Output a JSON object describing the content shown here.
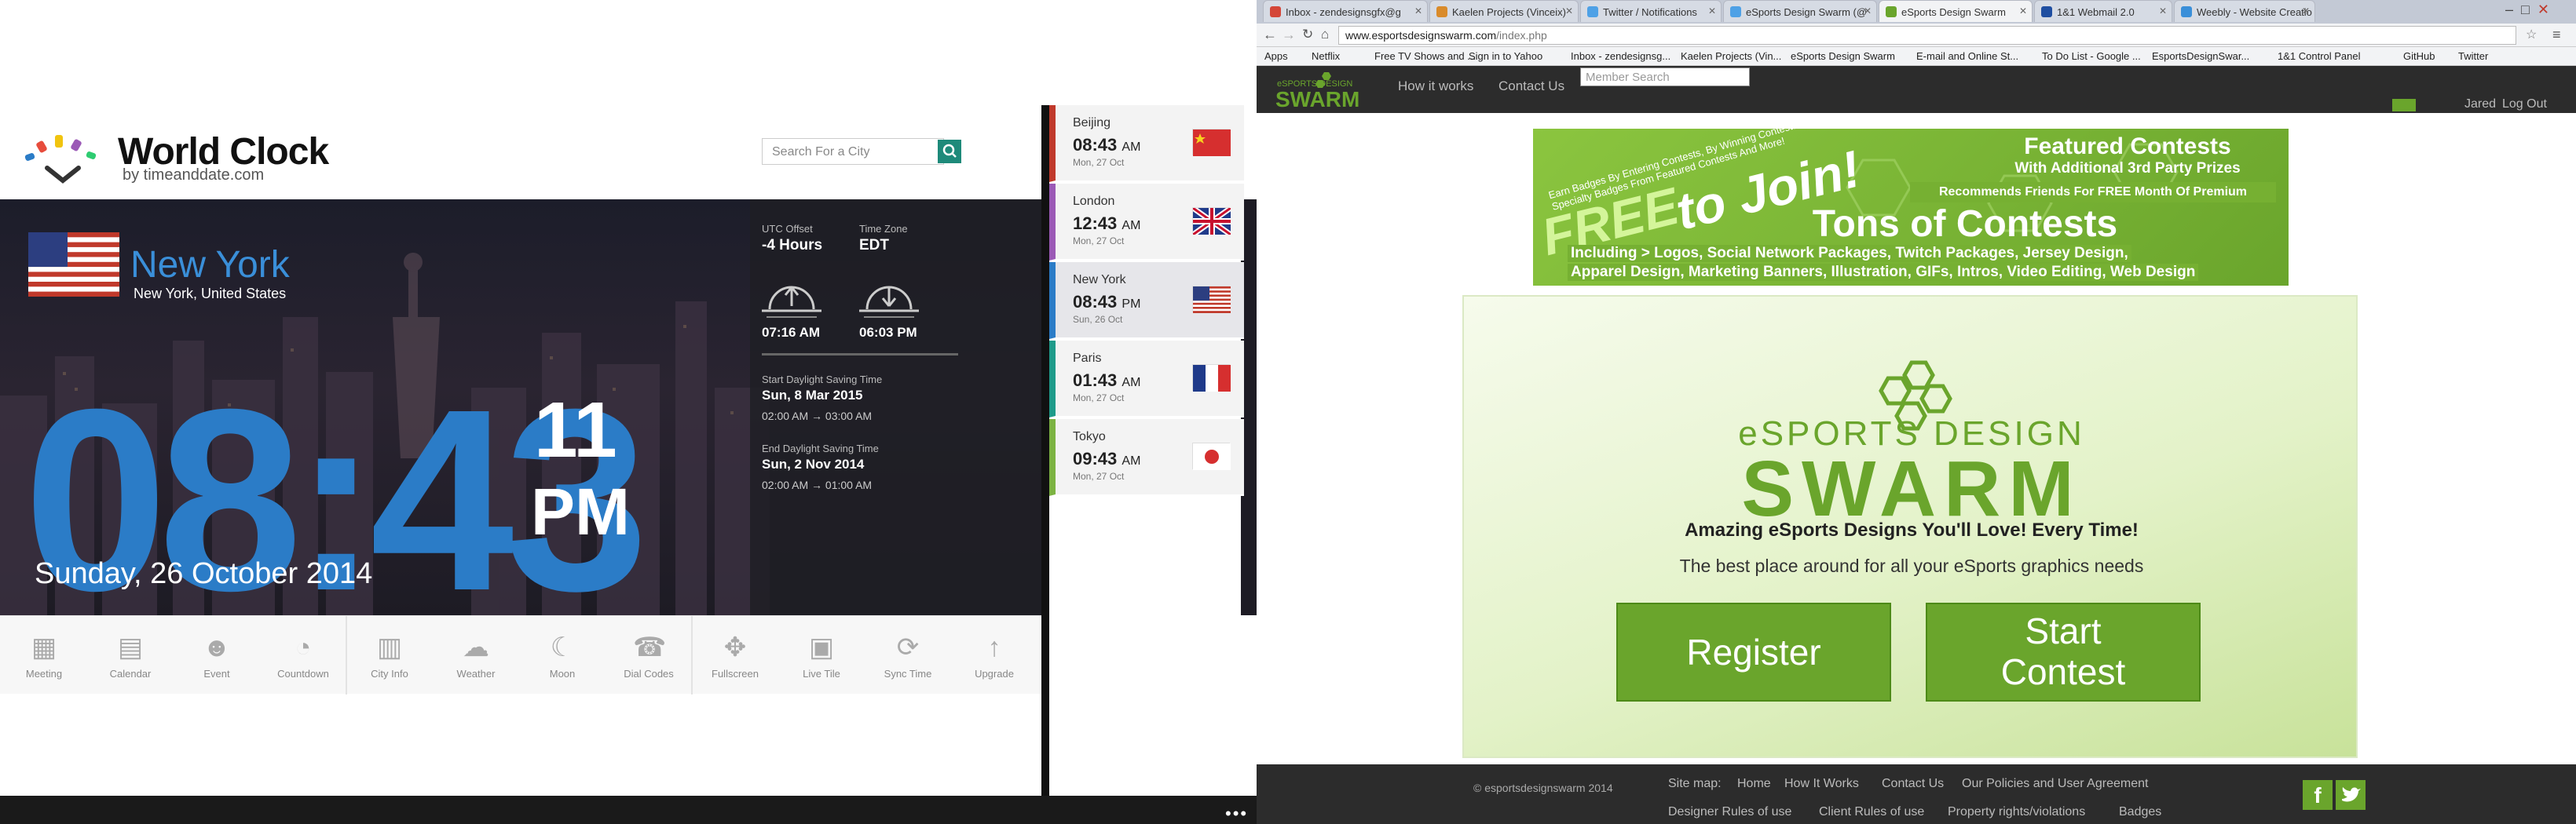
{
  "world_clock": {
    "logo_title": "World Clock",
    "logo_sub": "by timeanddate.com",
    "search_placeholder": "Search For a City",
    "city": "New York",
    "city_full": "New York, United States",
    "utc_offset_label": "UTC Offset",
    "utc_offset": "-4 Hours",
    "tz_label": "Time Zone",
    "tz": "EDT",
    "sunrise": "07:16 AM",
    "sunset": "06:03 PM",
    "dst_start_label": "Start Daylight Saving Time",
    "dst_start": "Sun, 8 Mar 2015",
    "dst_start_change": "02:00 AM → 03:00 AM",
    "dst_end_label": "End Daylight Saving Time",
    "dst_end": "Sun, 2 Nov 2014",
    "dst_end_change": "02:00 AM → 01:00 AM",
    "time_hm": "08:43",
    "seconds": "11",
    "ampm": "PM",
    "date": "Sunday, 26 October 2014",
    "toolbar": [
      "Meeting",
      "Calendar",
      "Event",
      "Countdown",
      "City Info",
      "Weather",
      "Moon",
      "Dial Codes",
      "Fullscreen",
      "Live Tile",
      "Sync Time",
      "Upgrade"
    ],
    "cities": [
      {
        "name": "Beijing",
        "time": "08:43",
        "ampm": "AM",
        "date": "Mon, 27 Oct",
        "color": "#c0392b"
      },
      {
        "name": "London",
        "time": "12:43",
        "ampm": "AM",
        "date": "Mon, 27 Oct",
        "color": "#9b59b6"
      },
      {
        "name": "New York",
        "time": "08:43",
        "ampm": "PM",
        "date": "Sun, 26 Oct",
        "color": "#2b7cc7"
      },
      {
        "name": "Paris",
        "time": "01:43",
        "ampm": "AM",
        "date": "Mon, 27 Oct",
        "color": "#1e9b8a"
      },
      {
        "name": "Tokyo",
        "time": "09:43",
        "ampm": "AM",
        "date": "Mon, 27 Oct",
        "color": "#7cb342"
      }
    ]
  },
  "browser": {
    "tabs": [
      "Inbox - zendesignsgfx@g",
      "Kaelen Projects (Vinceix)",
      "Twitter / Notifications",
      "eSports Design Swarm (@",
      "eSports Design Swarm",
      "1&1 Webmail 2.0",
      "Weebly - Website Creatio"
    ],
    "url_host": "www.esportsdesignswarm.com",
    "url_path": "/index.php",
    "bookmarks": [
      "Apps",
      "Netflix",
      "Free TV Shows and ...",
      "Sign in to Yahoo",
      "Inbox - zendesignsg...",
      "Kaelen Projects (Vin...",
      "eSports Design Swarm",
      "E-mail and Online St...",
      "To Do List - Google ...",
      "EsportsDesignSwar...",
      "1&1 Control Panel",
      "GitHub",
      "Twitter"
    ]
  },
  "site": {
    "nav": [
      "How it works",
      "Contact Us"
    ],
    "member_search_placeholder": "Member Search",
    "user": "Jared",
    "logout": "Log Out",
    "banner": {
      "free": "FREE",
      "to_join": "to Join!",
      "small_text": "Earn Badges By Entering Contests, By Winning Contests And Win Specialty Badges From Featured Contests And More!",
      "featured_title": "Featured Contests",
      "featured_sub": "With Additional 3rd Party Prizes",
      "recommend": "Recommends Friends For FREE Month Of Premium",
      "tons": "Tons of Contests",
      "including": "Including > Logos, Social Network Packages, Twitch Packages, Jersey Design,",
      "including2": "Apparel Design, Marketing Banners, Illustration, GIFs, Intros, Video Editing, Web Design"
    },
    "logo_top": "eSPORTS DESIGN",
    "logo_bottom": "SWARM",
    "tagline": "Amazing eSports Designs You'll Love! Every Time!",
    "subtagline": "The best place around for all your eSports graphics needs",
    "register": "Register",
    "start": "Start",
    "contest": "Contest",
    "copyright": "© esportsdesignswarm 2014",
    "sitemap_label": "Site map:",
    "footer_links": [
      "Home",
      "How It Works",
      "Contact Us",
      "Our Policies and User Agreement"
    ],
    "footer_links2": [
      "Designer Rules of use",
      "Client Rules of use",
      "Property rights/violations",
      "Badges"
    ]
  }
}
